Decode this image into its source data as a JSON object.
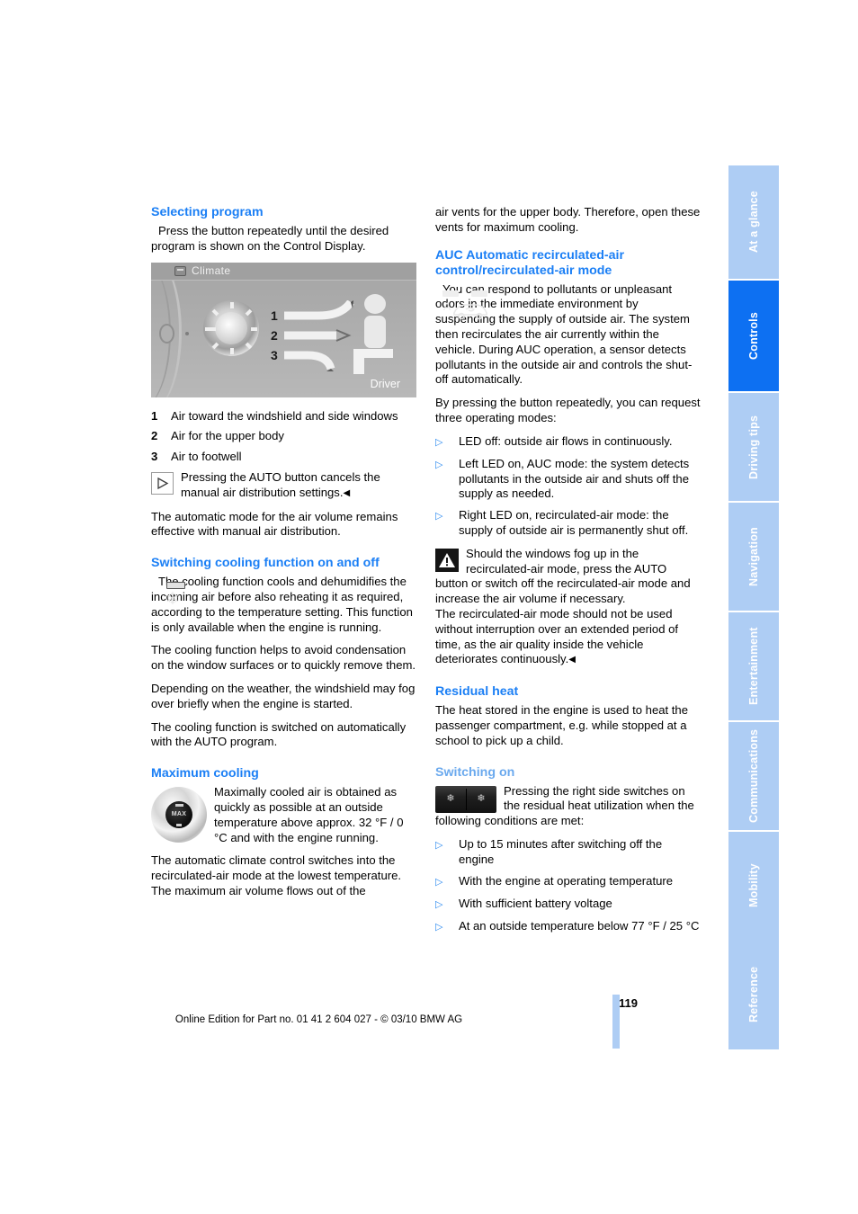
{
  "side_tabs": [
    {
      "label": "At a glance",
      "active": false
    },
    {
      "label": "Controls",
      "active": true
    },
    {
      "label": "Driving tips",
      "active": false
    },
    {
      "label": "Navigation",
      "active": false
    },
    {
      "label": "Entertainment",
      "active": false
    },
    {
      "label": "Communications",
      "active": false
    },
    {
      "label": "Mobility",
      "active": false
    },
    {
      "label": "Reference",
      "active": false
    }
  ],
  "colors": {
    "heading_blue": "#1b7ff5",
    "subheading_blue": "#6aa9ee",
    "tab_inactive": "#aecdf4",
    "tab_active": "#0d70f2",
    "bullet_blue": "#2e8bf0"
  },
  "left_column": {
    "heading_selecting_program": "Selecting program",
    "program_icon_text": "Press the button repeatedly until the desired program is shown on the Control Display.",
    "climate_figure": {
      "title": "Climate",
      "labels": [
        "1",
        "2",
        "3"
      ],
      "driver_label": "Driver"
    },
    "legend": [
      {
        "num": "1",
        "text": "Air toward the windshield and side windows"
      },
      {
        "num": "2",
        "text": "Air for the upper body"
      },
      {
        "num": "3",
        "text": "Air to footwell"
      }
    ],
    "note_auto_button": "Pressing the AUTO button cancels the manual air distribution settings.",
    "note_end_marker": "◀",
    "para_auto_mode": "The automatic mode for the air volume remains effective with manual air distribution.",
    "heading_cooling": "Switching cooling function on and off",
    "cooling_icon_text": "The cooling function cools and dehumidifies the incoming air before also reheating it as required, according to the temperature setting. This function is only available when the engine is running.",
    "para_condensation": "The cooling function helps to avoid condensation on the window surfaces or to quickly remove them.",
    "para_fog": "Depending on the weather, the windshield may fog over briefly when the engine is started.",
    "para_auto_program": "The cooling function is switched on automatically with the AUTO program.",
    "heading_max_cooling": "Maximum cooling",
    "max_cooling_icon_text": "Maximally cooled air is obtained as quickly as possible at an outside temperature above approx. 32 °F / 0 °C and with the engine running.",
    "para_recirc_lowest": "The automatic climate control switches into the recirculated-air mode at the lowest temperature. The maximum air volume flows out of the",
    "knob_label": "MAX"
  },
  "right_column": {
    "para_continued": "air vents for the upper body. Therefore, open these vents for maximum cooling.",
    "heading_auc": "AUC Automatic recirculated-air control/recirculated-air mode",
    "auc_icon_text": "You can respond to pollutants or unpleasant odors in the immediate environment by suspending the supply of outside air. The system then recirculates the air currently within the vehicle. During AUC operation, a sensor detects pollutants in the outside air and controls the shut-off automatically.",
    "para_three_modes": "By pressing the button repeatedly, you can request three operating modes:",
    "mode_bullets": [
      "LED off: outside air flows in continuously.",
      "Left LED on, AUC mode: the system detects pollutants in the outside air and shuts off the supply as needed.",
      "Right LED on, recirculated-air mode: the supply of outside air is permanently shut off."
    ],
    "warning_text": "Should the windows fog up in the recirculated-air mode, press the AUTO button or switch off the recirculated-air mode and increase the air volume if necessary.",
    "warning_cont": "The recirculated-air mode should not be used without interruption over an extended period of time, as the air quality inside the vehicle deteriorates continuously.",
    "warning_end_marker": "◀",
    "heading_residual_heat": "Residual heat",
    "para_residual": "The heat stored in the engine is used to heat the passenger compartment, e.g. while stopped at a school to pick up a child.",
    "heading_switching_on": "Switching on",
    "switching_icon_text": "Pressing the right side switches on the residual heat utilization when the following conditions are met:",
    "condition_bullets": [
      "Up to 15 minutes after switching off the engine",
      "With the engine at operating temperature",
      "With sufficient battery voltage",
      "At an outside temperature below 77 °F / 25 °C"
    ],
    "auc_icon_letter": "A"
  },
  "footer": {
    "page_number": "119",
    "edition_line": "Online Edition for Part no. 01 41 2 604 027 - © 03/10 BMW AG"
  }
}
